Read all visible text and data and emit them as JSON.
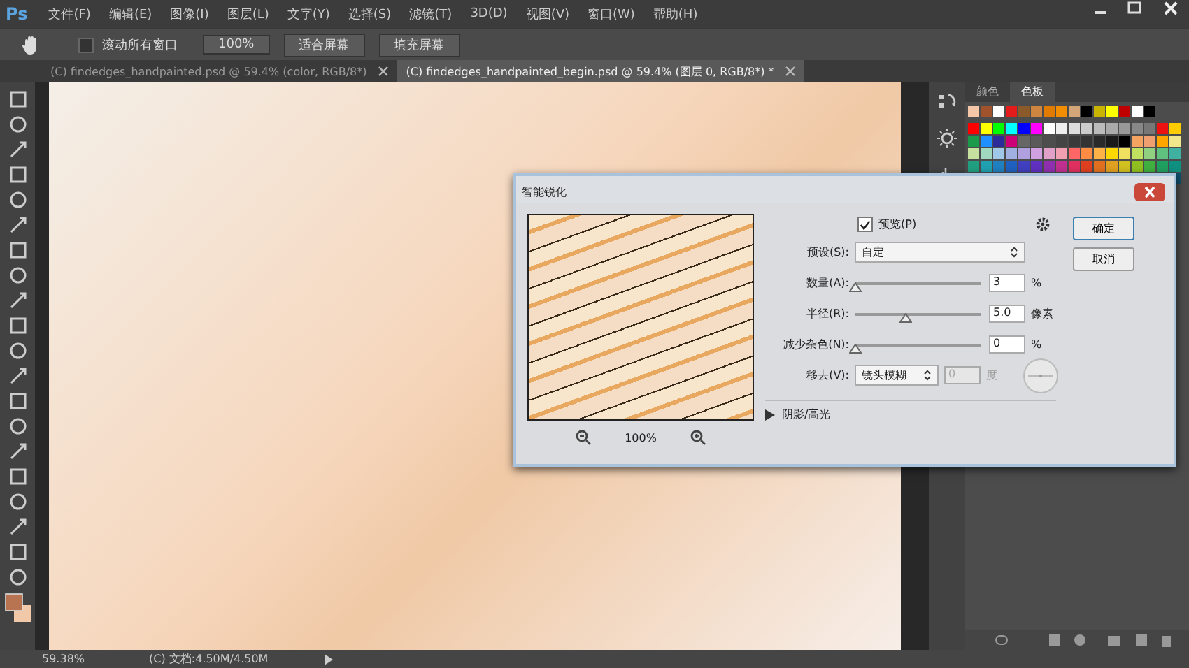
{
  "app": {
    "logo": "Ps"
  },
  "menu": [
    "文件(F)",
    "编辑(E)",
    "图像(I)",
    "图层(L)",
    "文字(Y)",
    "选择(S)",
    "滤镜(T)",
    "3D(D)",
    "视图(V)",
    "窗口(W)",
    "帮助(H)"
  ],
  "options_bar": {
    "scroll_all": {
      "label": "滚动所有窗口",
      "checked": false
    },
    "buttons": [
      "100%",
      "适合屏幕",
      "填充屏幕"
    ]
  },
  "tabs": [
    {
      "label": "(C) findedges_handpainted.psd @ 59.4% (color, RGB/8*)",
      "selected": false
    },
    {
      "label": "(C) findedges_handpainted_begin.psd @ 59.4% (图层 0, RGB/8*) *",
      "selected": true
    }
  ],
  "panel_tabs": [
    {
      "label": "颜色",
      "selected": false
    },
    {
      "label": "色板",
      "selected": true
    }
  ],
  "dialog": {
    "title": "智能锐化",
    "preview": {
      "label": "预览(P)",
      "checked": true
    },
    "ok": "确定",
    "cancel": "取消",
    "preset": {
      "label": "预设(S):",
      "value": "自定"
    },
    "sliders": [
      {
        "label": "数量(A):",
        "value": "3",
        "unit": "%",
        "level": 0
      },
      {
        "label": "半径(R):",
        "value": "5.0",
        "unit": "像素",
        "level": 0.4
      },
      {
        "label": "减少杂色(N):",
        "value": "0",
        "unit": "%",
        "level": 0
      }
    ],
    "remove": {
      "label": "移去(V):",
      "value": "镜头模糊",
      "angle": "0",
      "angle_disabled": true,
      "unit": "度"
    },
    "zoom": "100%",
    "section": {
      "label": "阴影/高光",
      "expanded": false
    }
  },
  "status_bar": {
    "zoom": "59.38%",
    "doc": "(C) 文档:4.50M/4.50M"
  }
}
